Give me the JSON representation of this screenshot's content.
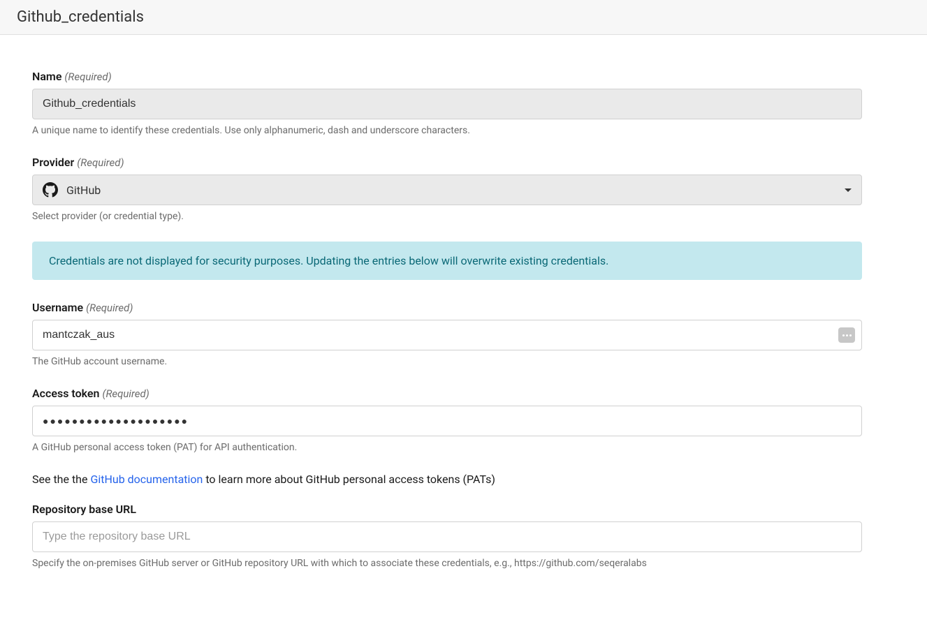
{
  "header": {
    "title": "Github_credentials"
  },
  "form": {
    "name": {
      "label": "Name",
      "required": "(Required)",
      "value": "Github_credentials",
      "help": "A unique name to identify these credentials. Use only alphanumeric, dash and underscore characters."
    },
    "provider": {
      "label": "Provider",
      "required": "(Required)",
      "value": "GitHub",
      "help": "Select provider (or credential type)."
    },
    "banner": {
      "text": "Credentials are not displayed for security purposes. Updating the entries below will overwrite existing credentials."
    },
    "username": {
      "label": "Username",
      "required": "(Required)",
      "value": "mantczak_aus",
      "help": "The GitHub account username."
    },
    "token": {
      "label": "Access token",
      "required": "(Required)",
      "value": "●●●●●●●●●●●●●●●●●●●●",
      "help": "A GitHub personal access token (PAT) for API authentication."
    },
    "doc": {
      "prefix": "See the the ",
      "link": "GitHub documentation",
      "suffix": " to learn more about GitHub personal access tokens (PATs)"
    },
    "repo": {
      "label": "Repository base URL",
      "placeholder": "Type the repository base URL",
      "help": "Specify the on-premises GitHub server or GitHub repository URL with which to associate these credentials, e.g., https://github.com/seqeralabs"
    }
  }
}
